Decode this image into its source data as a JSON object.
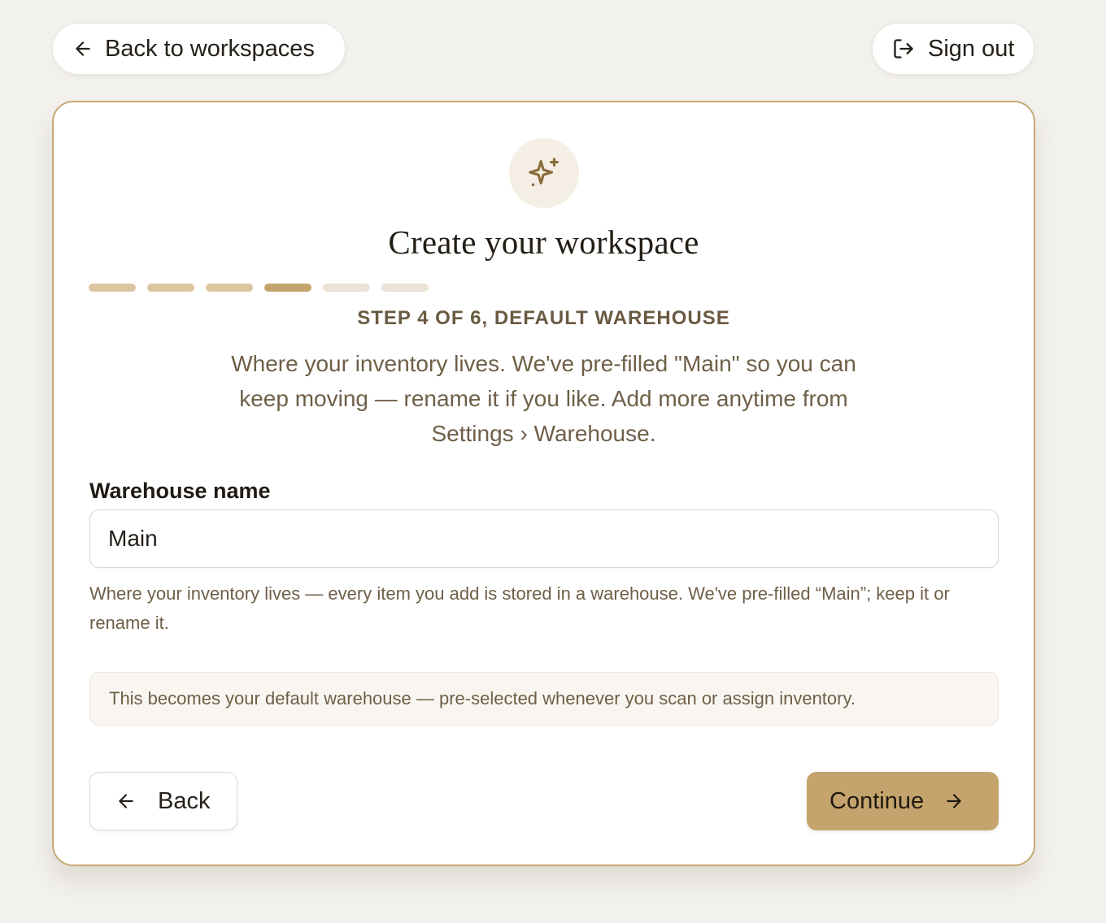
{
  "header": {
    "back_label": "Back to workspaces",
    "back_icon": "arrow-left-icon",
    "signout_label": "Sign out",
    "signout_icon": "log-out-icon"
  },
  "card": {
    "badge_icon": "sparkles-icon",
    "title": "Create your workspace",
    "progress": {
      "total_steps": 6,
      "current_step": 4
    },
    "step_label": "STEP 4 OF 6, DEFAULT WAREHOUSE",
    "description": "Where your inventory lives. We've pre-filled \"Main\" so you can keep moving — rename it if you like. Add more anytime from Settings › Warehouse."
  },
  "form": {
    "warehouse_label": "Warehouse name",
    "warehouse_value": "Main",
    "help_text": "Where your inventory lives — every item you add is stored in a warehouse. We've pre-filled “Main”; keep it or rename it.",
    "note": "This becomes your default warehouse — pre-selected whenever you scan or assign inventory."
  },
  "footer": {
    "back_label": "Back",
    "back_icon": "arrow-left-icon",
    "continue_label": "Continue",
    "continue_icon": "arrow-right-icon"
  },
  "colors": {
    "background": "#f3f1ed",
    "accent": "#c4a46c",
    "card_border": "#c8a874",
    "progress_done": "#dcc5a0",
    "progress_todo": "#ece3d6",
    "muted_text": "#6f5f47"
  }
}
